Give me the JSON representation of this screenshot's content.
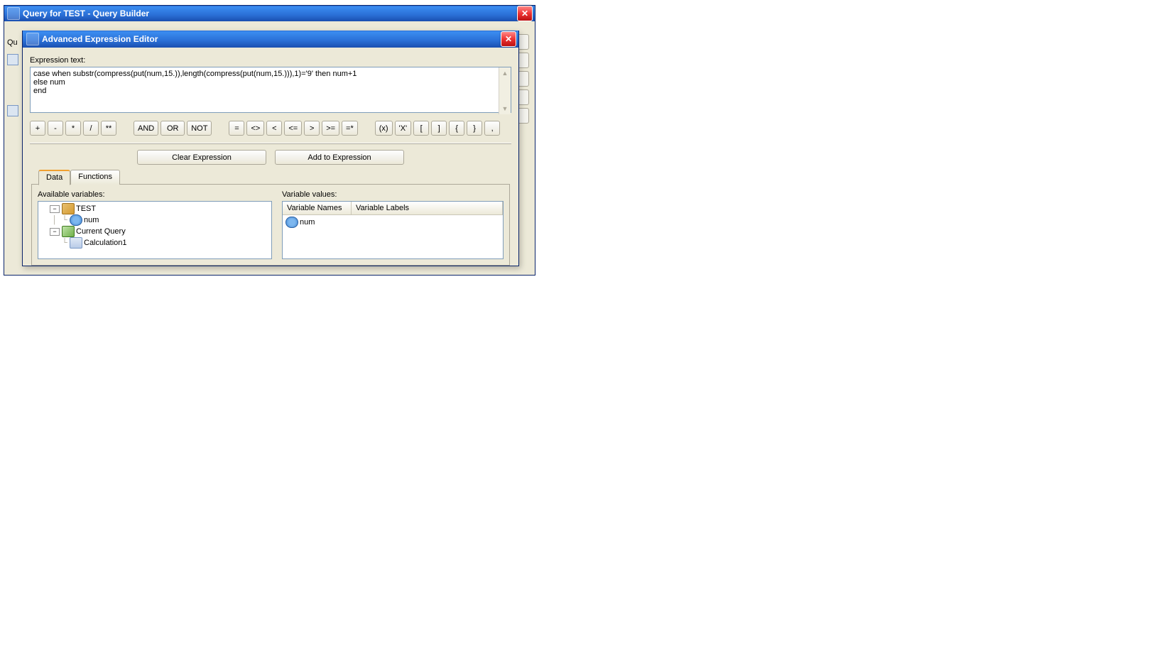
{
  "parentWindow": {
    "title": "Query for TEST - Query Builder",
    "bgLabel": "Qu"
  },
  "dialog": {
    "title": "Advanced Expression Editor",
    "expressionLabel": "Expression text:",
    "expressionText": "case when substr(compress(put(num,15.)),length(compress(put(num,15.))),1)='9' then num+1\nelse num\nend",
    "clearBtn": "Clear Expression",
    "addBtn": "Add to Expression"
  },
  "ops": {
    "plus": "+",
    "minus": "-",
    "mul": "*",
    "div": "/",
    "exp": "**",
    "and": "AND",
    "or": "OR",
    "not": "NOT",
    "eq": "=",
    "ne": "<>",
    "lt": "<",
    "le": "<=",
    "gt": ">",
    "ge": ">=",
    "eqstar": "=*",
    "paren": "(x)",
    "quote": "'X'",
    "lb": "[",
    "rb": "]",
    "lc": "{",
    "rc": "}",
    "comma": ","
  },
  "tabs": {
    "data": "Data",
    "functions": "Functions"
  },
  "left": {
    "label": "Available variables:",
    "tree": {
      "root": "TEST",
      "rootChild": "num",
      "query": "Current Query",
      "calc": "Calculation1"
    }
  },
  "right": {
    "label": "Variable values:",
    "h1": "Variable Names",
    "h2": "Variable Labels",
    "row1": "num"
  }
}
